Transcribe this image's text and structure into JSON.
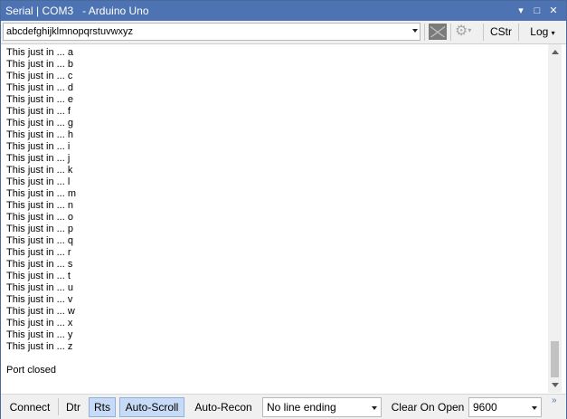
{
  "window": {
    "title": "Serial | COM3   - Arduino Uno",
    "menu_glyph": "▾",
    "maximize_glyph": "□",
    "close_glyph": "✕"
  },
  "toolbar": {
    "send_value": "abcdefghijklmnopqrstuvwxyz",
    "cstr_label": "CStr",
    "log_label": "Log",
    "log_glyph": "▾",
    "gear_glyph": "⚙",
    "gear_caret": "▾"
  },
  "output": {
    "lines": [
      "This just in ... a",
      "This just in ... b",
      "This just in ... c",
      "This just in ... d",
      "This just in ... e",
      "This just in ... f",
      "This just in ... g",
      "This just in ... h",
      "This just in ... i",
      "This just in ... j",
      "This just in ... k",
      "This just in ... l",
      "This just in ... m",
      "This just in ... n",
      "This just in ... o",
      "This just in ... p",
      "This just in ... q",
      "This just in ... r",
      "This just in ... s",
      "This just in ... t",
      "This just in ... u",
      "This just in ... v",
      "This just in ... w",
      "This just in ... x",
      "This just in ... y",
      "This just in ... z",
      "",
      "Port closed"
    ]
  },
  "statusbar": {
    "connect_label": "Connect",
    "dtr_label": "Dtr",
    "rts_label": "Rts",
    "autoscroll_label": "Auto-Scroll",
    "autorecon_label": "Auto-Recon",
    "line_ending_value": "No line ending",
    "clear_on_open_label": "Clear On Open",
    "baud_value": "9600",
    "overflow_glyph": "»"
  },
  "colors": {
    "titlebar": "#4e73b2",
    "active_toggle": "#c7dbf6"
  }
}
